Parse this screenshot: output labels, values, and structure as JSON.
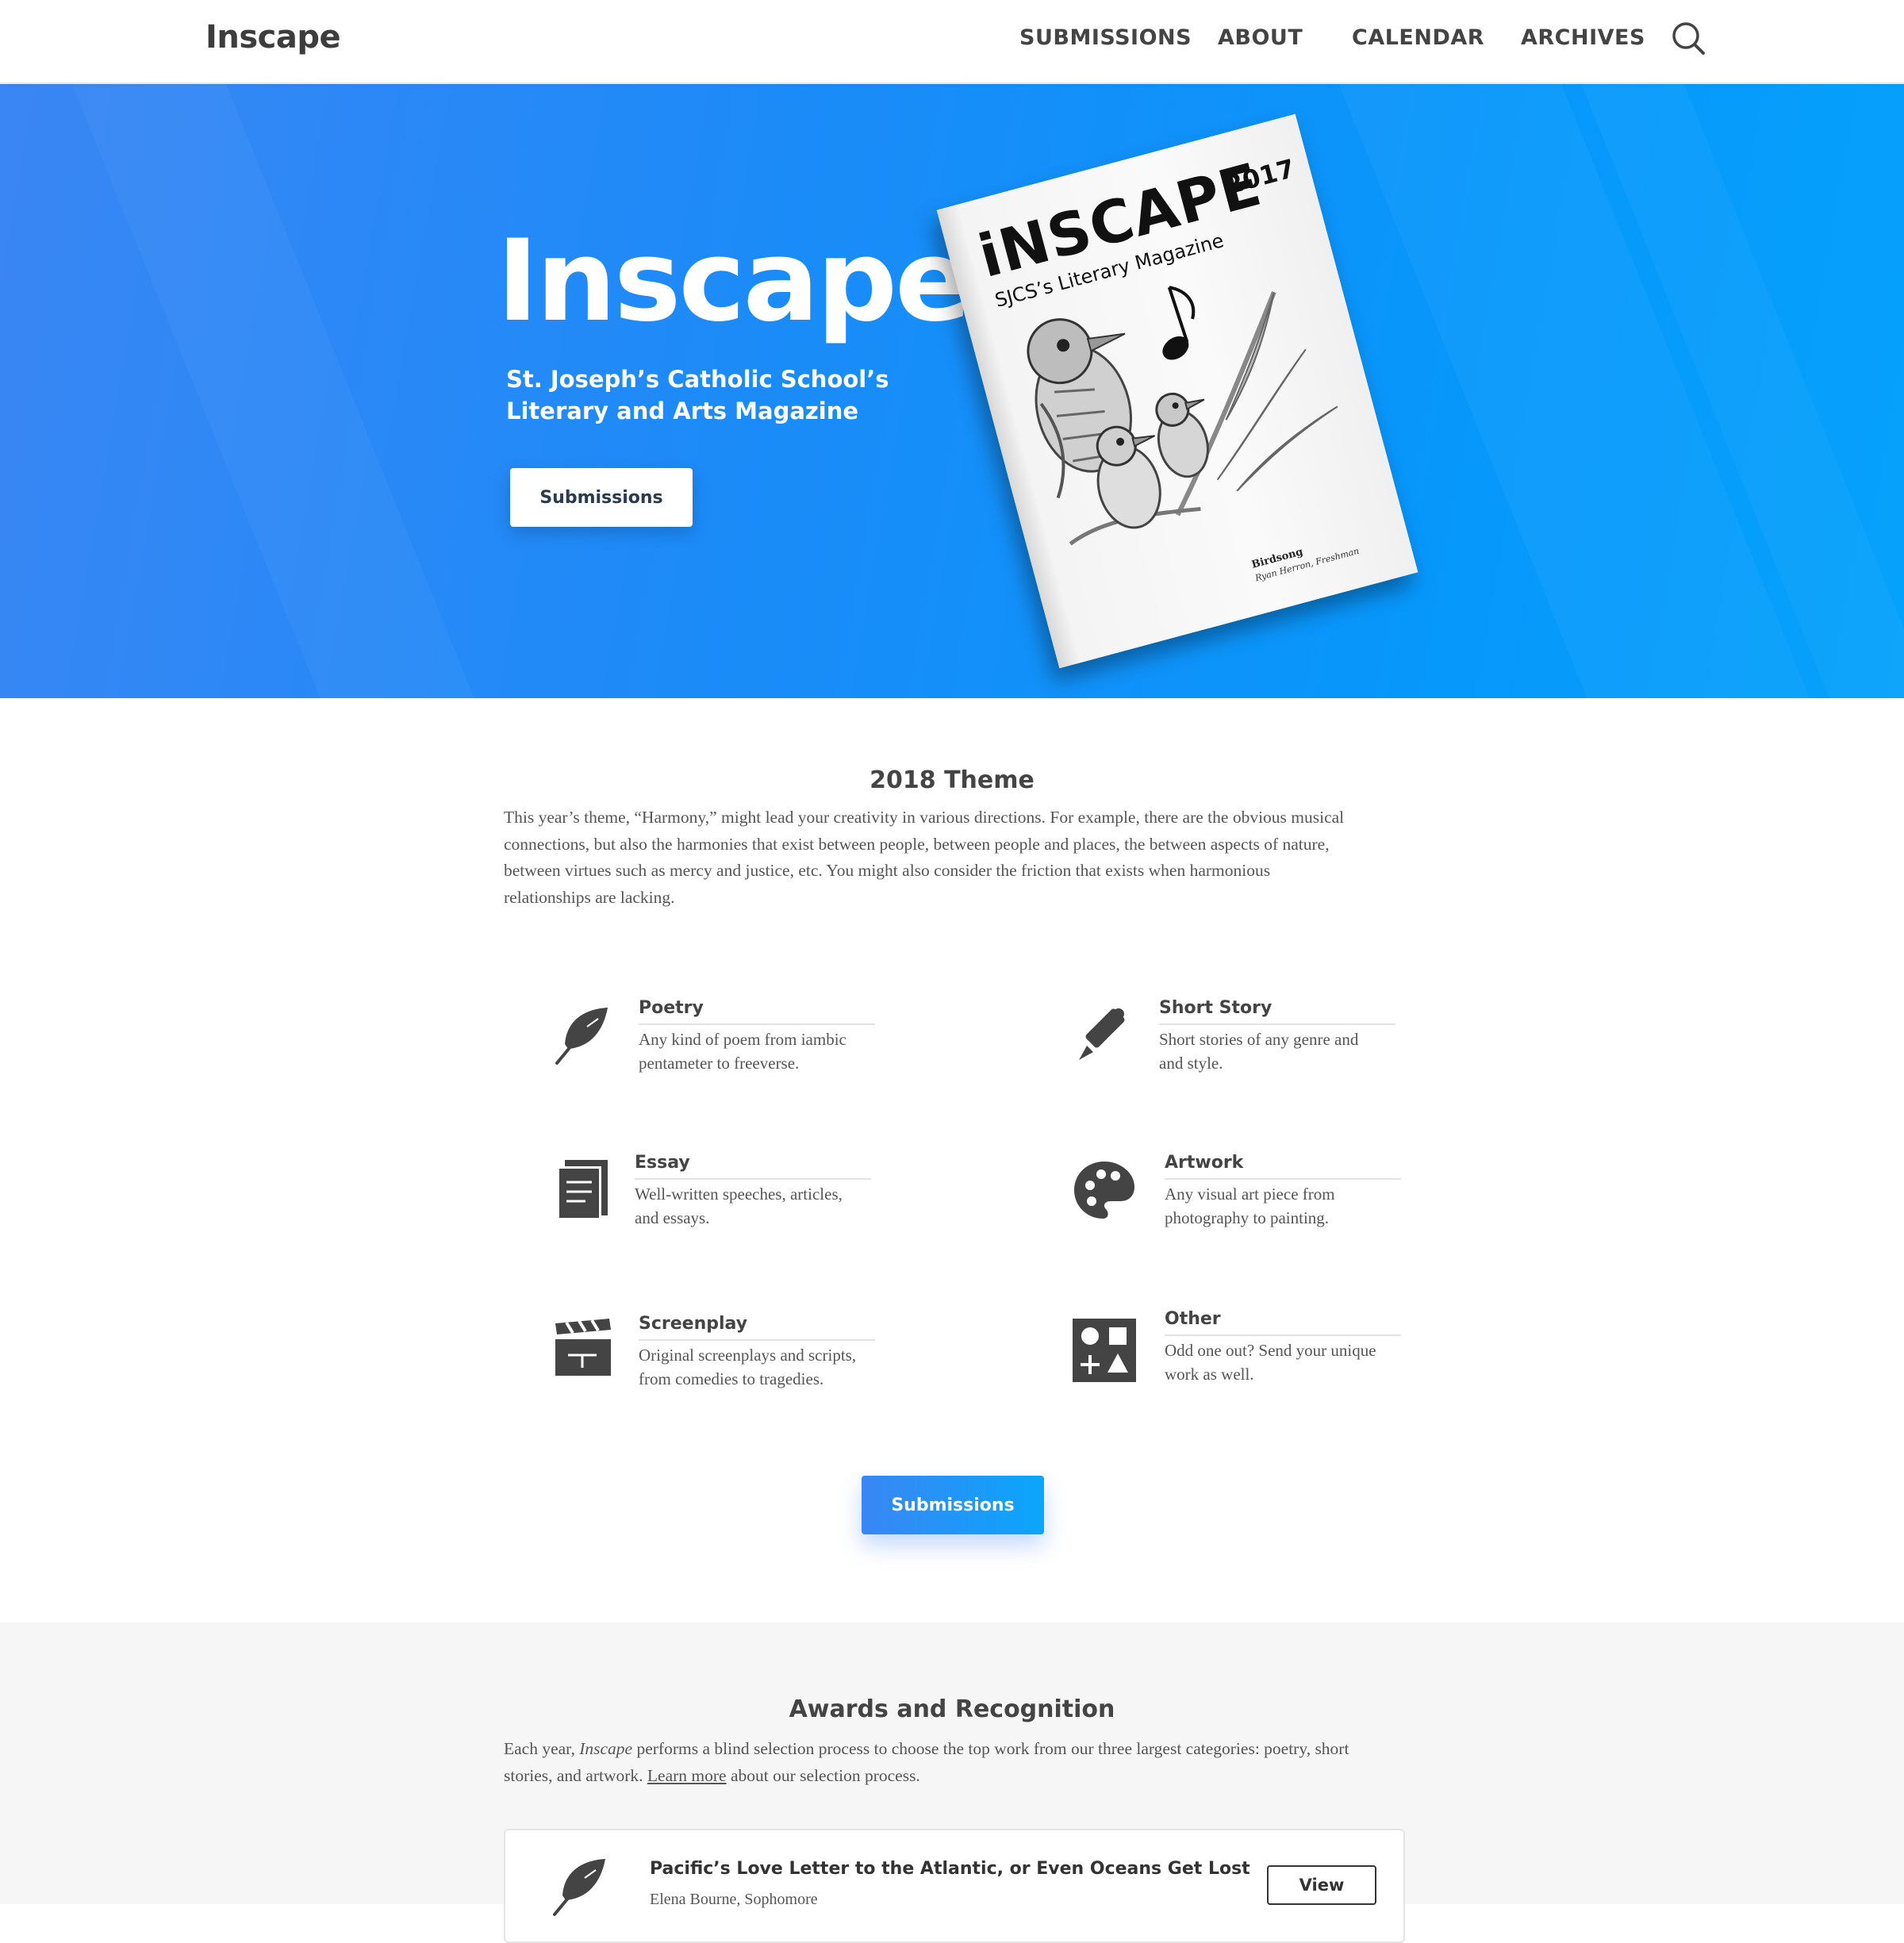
{
  "nav": {
    "logo": "Inscape",
    "items": [
      "SUBMISSIONS",
      "ABOUT",
      "CALENDAR",
      "ARCHIVES"
    ],
    "search_icon": "search-icon"
  },
  "hero": {
    "title": "Inscape",
    "subtitle_line1": "St. Joseph’s Catholic School’s",
    "subtitle_line2": "Literary and Arts Magazine",
    "button": "Submissions",
    "colors": {
      "gradient_start": "#3a86f4",
      "gradient_end": "#05a2fb"
    },
    "book": {
      "title": "iNSCAPE",
      "year": "2017",
      "subtitle": "SJCS’s Literary Magazine",
      "caption_title": "Birdsong",
      "caption_author": "Ryan Herron, Freshman"
    }
  },
  "theme": {
    "heading": "2018 Theme",
    "line1": "This year’s theme, “Harmony,” might lead your creativity in various directions. For example, there are the obvious musical",
    "line2": "connections, but also the harmonies that exist between people, between people and places, the between aspects of nature,",
    "line3": "between virtues such as mercy and justice, etc. You might also consider the friction that exists when harmonious",
    "line4": "relationships are lacking."
  },
  "categories": [
    {
      "title": "Poetry",
      "desc1": "Any kind of poem from iambic",
      "desc2": "pentameter to freeverse.",
      "icon": "feather-icon"
    },
    {
      "title": "Short Story",
      "desc1": "Short stories of any genre and",
      "desc2": "and style.",
      "icon": "pen-icon"
    },
    {
      "title": "Essay",
      "desc1": "Well-written speeches, articles,",
      "desc2": "and essays.",
      "icon": "document-icon"
    },
    {
      "title": "Artwork",
      "desc1": "Any visual art piece from",
      "desc2": "photography to painting.",
      "icon": "palette-icon"
    },
    {
      "title": "Screenplay",
      "desc1": "Original screenplays and scripts,",
      "desc2": "from comedies to tragedies.",
      "icon": "clapperboard-icon"
    },
    {
      "title": "Other",
      "desc1": "Odd one out?  Send your unique",
      "desc2": "work as well.",
      "icon": "shapes-icon"
    }
  ],
  "submit_button": "Submissions",
  "awards": {
    "heading": "Awards and Recognition",
    "p1_before": "Each year, ",
    "p1_em": "Inscape",
    "p1_after": " performs a blind selection process to choose the top work from our three largest categories: poetry, short",
    "p2_before": "stories, and artwork.  ",
    "p2_link": "Learn more",
    "p2_after": " about our selection process.",
    "card": {
      "title": "Pacific’s Love Letter to the Atlantic, or Even Oceans Get Lost",
      "author": "Elena Bourne, Sophomore",
      "button": "View",
      "icon": "feather-icon"
    }
  }
}
